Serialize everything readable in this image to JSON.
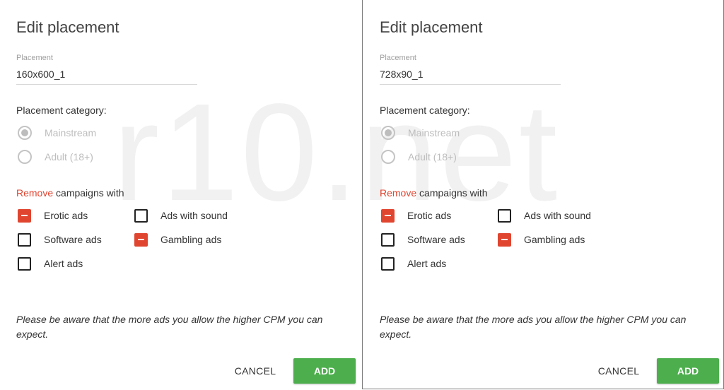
{
  "watermark": "r10.net",
  "accent_colors": {
    "remove": "#e04530",
    "add_button": "#4cae4c"
  },
  "panels": [
    {
      "title": "Edit placement",
      "field_label": "Placement",
      "field_value": "160x600_1",
      "category_label": "Placement category:",
      "radios": [
        {
          "label": "Mainstream",
          "checked": true
        },
        {
          "label": "Adult (18+)",
          "checked": false
        }
      ],
      "remove_word": "Remove",
      "remove_rest": " campaigns with",
      "checkboxes": [
        {
          "label": "Erotic ads",
          "state": "excluded"
        },
        {
          "label": "Ads with sound",
          "state": "unchecked"
        },
        {
          "label": "Software ads",
          "state": "unchecked"
        },
        {
          "label": "Gambling ads",
          "state": "excluded"
        },
        {
          "label": "Alert ads",
          "state": "unchecked"
        }
      ],
      "notice": "Please be aware that the more ads you allow the higher CPM you can expect.",
      "cancel_label": "CANCEL",
      "add_label": "ADD"
    },
    {
      "title": "Edit placement",
      "field_label": "Placement",
      "field_value": "728x90_1",
      "category_label": "Placement category:",
      "radios": [
        {
          "label": "Mainstream",
          "checked": true
        },
        {
          "label": "Adult (18+)",
          "checked": false
        }
      ],
      "remove_word": "Remove",
      "remove_rest": " campaigns with",
      "checkboxes": [
        {
          "label": "Erotic ads",
          "state": "excluded"
        },
        {
          "label": "Ads with sound",
          "state": "unchecked"
        },
        {
          "label": "Software ads",
          "state": "unchecked"
        },
        {
          "label": "Gambling ads",
          "state": "excluded"
        },
        {
          "label": "Alert ads",
          "state": "unchecked"
        }
      ],
      "notice": "Please be aware that the more ads you allow the higher CPM you can expect.",
      "cancel_label": "CANCEL",
      "add_label": "ADD"
    }
  ]
}
